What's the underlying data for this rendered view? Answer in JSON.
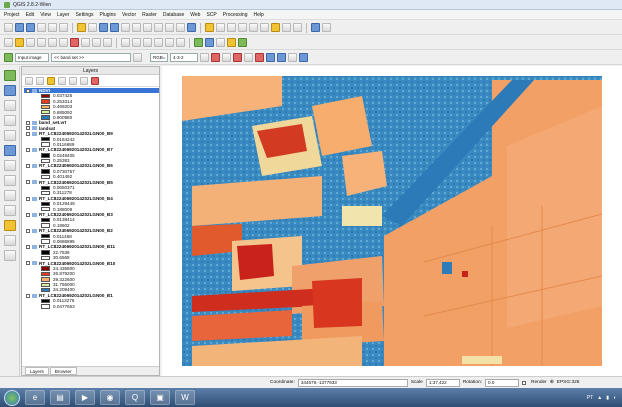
{
  "window": {
    "title": "QGIS 2.8.2-Wien"
  },
  "menu": [
    "Project",
    "Edit",
    "View",
    "Layer",
    "Settings",
    "Plugins",
    "Vector",
    "Raster",
    "Database",
    "Web",
    "SCP",
    "Processing",
    "Help"
  ],
  "toolbar3": {
    "input_image": "Input image",
    "band_set": "<< band set >>",
    "rgb_label": "RGB=",
    "rgb_value": "4-3-2"
  },
  "layers_panel": {
    "title": "Layers",
    "tabs": [
      "Layers",
      "Browser"
    ],
    "groups": [
      {
        "name": "NDVI",
        "selected": true,
        "classes": [
          {
            "value": "0.037425",
            "color": "#8b0000"
          },
          {
            "value": "0.253314",
            "color": "#e83a1e"
          },
          {
            "value": "0.469203",
            "color": "#f6b26b"
          },
          {
            "value": "0.685092",
            "color": "#d9ef9b"
          },
          {
            "value": "0.900980",
            "color": "#2b7bba"
          }
        ]
      },
      {
        "name": "band_set.vrt",
        "classes": []
      },
      {
        "name": "landsat",
        "classes": []
      },
      {
        "name": "RT_LC82240692014202LGN00_B9",
        "classes": [
          {
            "value": "0.0164242",
            "color": "#000000"
          },
          {
            "value": "0.0116689",
            "color": "#ffffff"
          }
        ]
      },
      {
        "name": "RT_LC82240692014202LGN00_B7",
        "classes": [
          {
            "value": "0.0248405",
            "color": "#000000"
          },
          {
            "value": "0.25383",
            "color": "#ffffff"
          }
        ]
      },
      {
        "name": "RT_LC82240692014202LGN00_B6",
        "classes": [
          {
            "value": "0.0730757",
            "color": "#000000"
          },
          {
            "value": "0.401492",
            "color": "#ffffff"
          }
        ]
      },
      {
        "name": "RT_LC82240692014202LGN00_B5",
        "classes": [
          {
            "value": "0.0650371",
            "color": "#000000"
          },
          {
            "value": "0.311278",
            "color": "#ffffff"
          }
        ]
      },
      {
        "name": "RT_LC82240692014202LGN00_B4",
        "classes": [
          {
            "value": "0.0129449",
            "color": "#000000"
          },
          {
            "value": "0.188009",
            "color": "#ffffff"
          }
        ]
      },
      {
        "name": "RT_LC82240692014202LGN00_B3",
        "classes": [
          {
            "value": "0.0138414",
            "color": "#000000"
          },
          {
            "value": "0.19602",
            "color": "#ffffff"
          }
        ]
      },
      {
        "name": "RT_LC82240692014202LGN00_B2",
        "classes": [
          {
            "value": "0.011468",
            "color": "#000000"
          },
          {
            "value": "0.0686895",
            "color": "#ffffff"
          }
        ]
      },
      {
        "name": "RT_LC82240692014202LGN00_B11",
        "classes": [
          {
            "value": "22.7536",
            "color": "#000000"
          },
          {
            "value": "30.6568",
            "color": "#ffffff"
          }
        ]
      },
      {
        "name": "RT_LC82240692014202LGN00_B10",
        "classes": [
          {
            "value": "24.435800",
            "color": "#8b0000"
          },
          {
            "value": "26.879200",
            "color": "#e83a1e"
          },
          {
            "value": "29.322600",
            "color": "#f6b26b"
          },
          {
            "value": "31.766000",
            "color": "#d9ef9b"
          },
          {
            "value": "34.209400",
            "color": "#2b7bba"
          }
        ]
      },
      {
        "name": "RT_LC82240692014202LGN00_B1",
        "classes": [
          {
            "value": "0.0113276",
            "color": "#000000"
          },
          {
            "value": "0.0477653",
            "color": "#ffffff"
          }
        ]
      }
    ]
  },
  "statusbar": {
    "coordinate_label": "Coordinate:",
    "coordinate_value": "344579,-1377933",
    "scale_label": "Scale",
    "scale_value": "1:37,422",
    "rotation_label": "Rotation:",
    "rotation_value": "0.0",
    "render_label": "Render",
    "epsg": "EPSG:326"
  },
  "taskbar": {
    "language": "PT"
  },
  "colors": {
    "ndvi_low": "#c4251d",
    "ndvi_mid": "#f4a460",
    "ndvi_high": "#3f8fc4",
    "selection": "#3875d7"
  }
}
